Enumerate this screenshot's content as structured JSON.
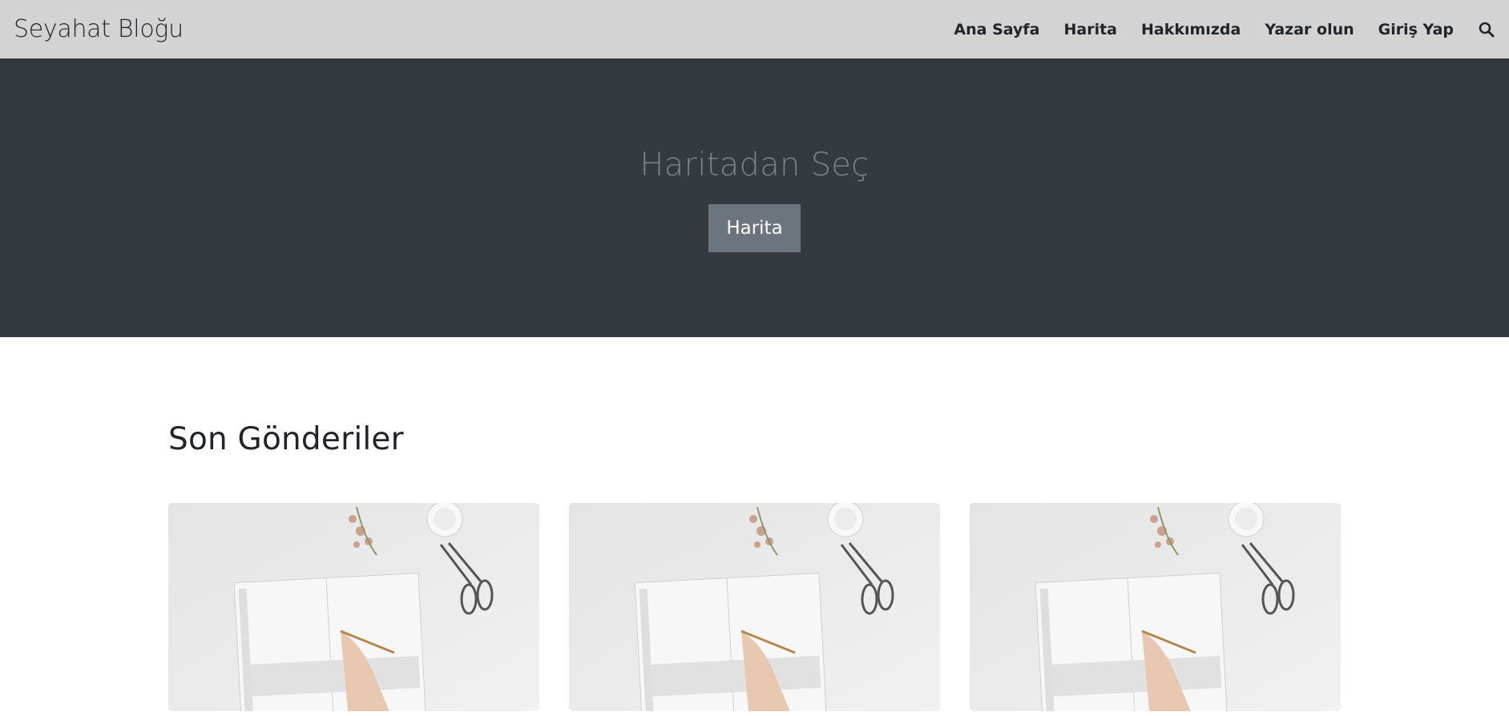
{
  "navbar": {
    "brand": "Seyahat Bloğu",
    "links": [
      {
        "label": "Ana Sayfa"
      },
      {
        "label": "Harita"
      },
      {
        "label": "Hakkımızda"
      },
      {
        "label": "Yazar olun"
      },
      {
        "label": "Giriş Yap"
      }
    ],
    "search_icon": "search-icon"
  },
  "hero": {
    "title": "Haritadan Seç",
    "button_label": "Harita"
  },
  "main": {
    "section_title": "Son Gönderiler",
    "cards": [
      {
        "image": "planner-desk-photo"
      },
      {
        "image": "planner-desk-photo"
      },
      {
        "image": "planner-desk-photo"
      }
    ]
  },
  "colors": {
    "navbar_bg": "#d3d3d3",
    "hero_bg": "#343a40",
    "hero_title": "#7d8084",
    "button_bg": "#6c757d"
  }
}
